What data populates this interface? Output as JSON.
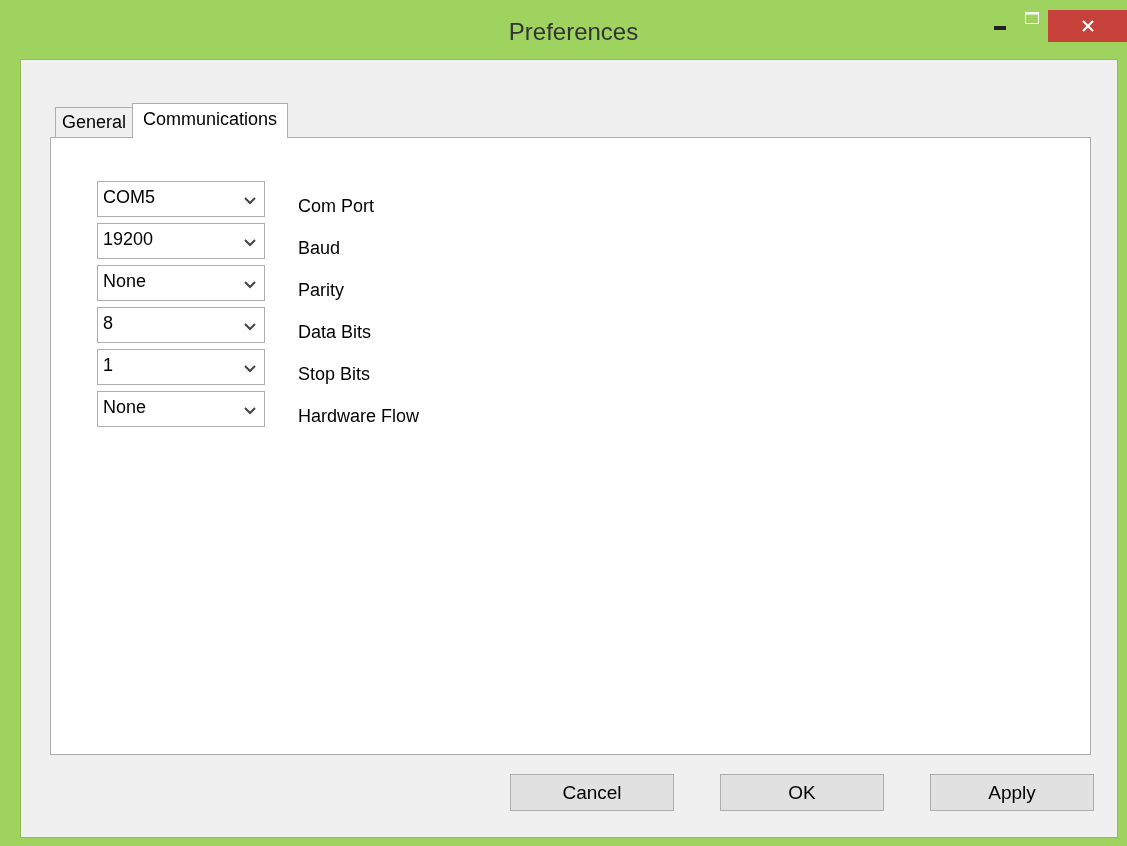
{
  "window": {
    "title": "Preferences"
  },
  "tabs": [
    {
      "label": "General",
      "selected": false
    },
    {
      "label": "Communications",
      "selected": true
    }
  ],
  "settings": [
    {
      "value": "COM5",
      "label": "Com Port"
    },
    {
      "value": "19200",
      "label": "Baud"
    },
    {
      "value": "None",
      "label": "Parity"
    },
    {
      "value": "8",
      "label": "Data Bits"
    },
    {
      "value": "1",
      "label": "Stop Bits"
    },
    {
      "value": "None",
      "label": "Hardware Flow"
    }
  ],
  "buttons": [
    "Cancel",
    "OK",
    "Apply"
  ]
}
